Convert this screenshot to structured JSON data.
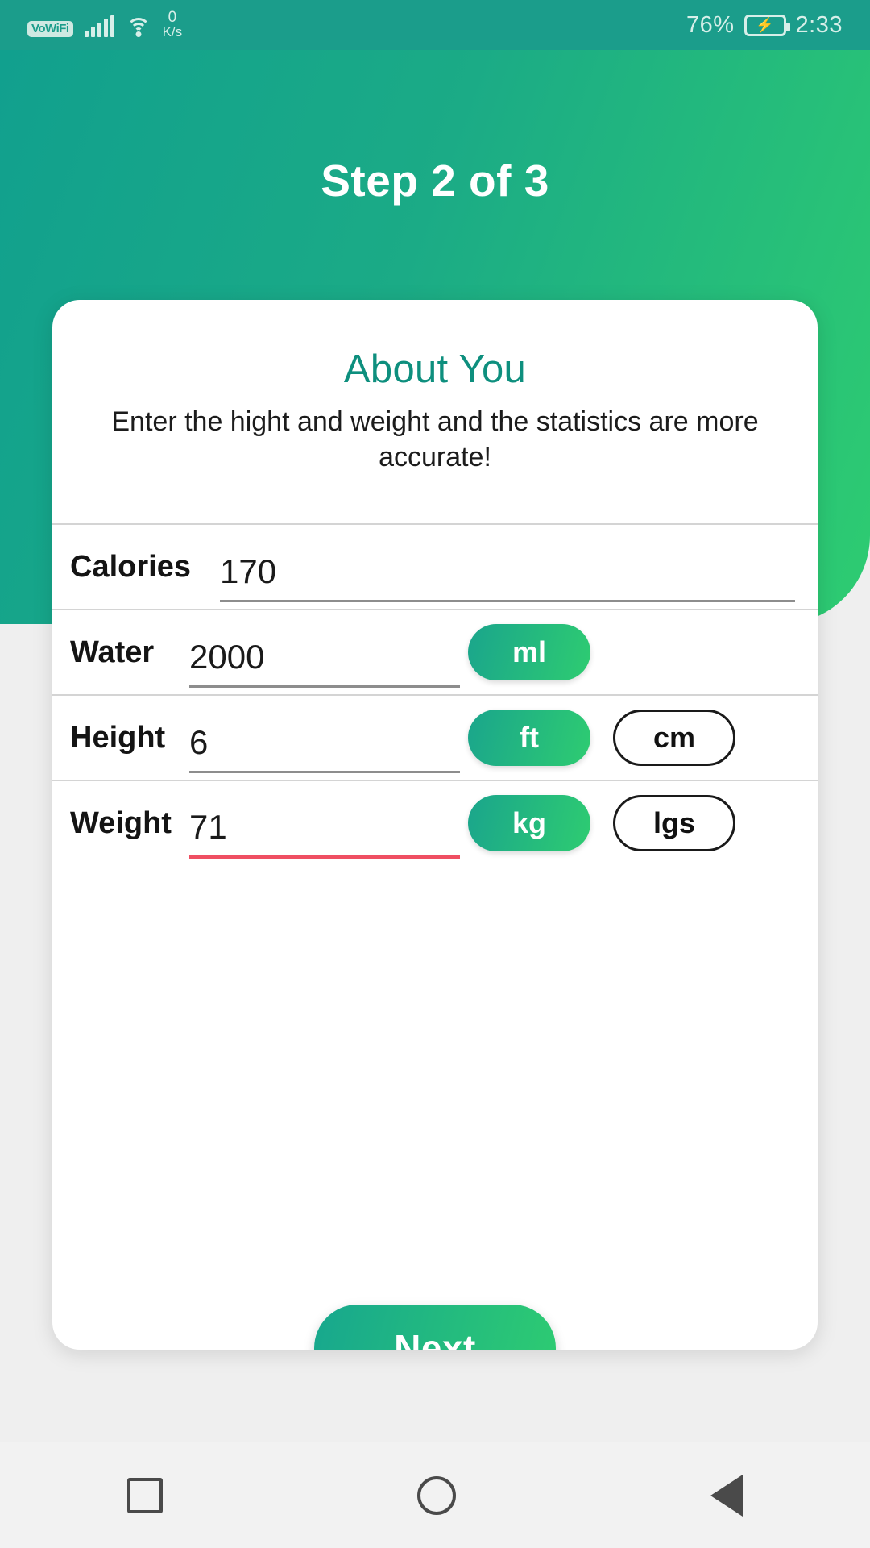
{
  "statusbar": {
    "vowifi_badge": "VoWiFi",
    "signal_icon": "signal-bars-icon",
    "wifi_icon": "wifi-icon",
    "net_speed_value": "0",
    "net_speed_unit": "K/s",
    "battery_percent": "76%",
    "battery_icon": "battery-charging-icon",
    "charging_glyph": "⚡",
    "time": "2:33",
    "background_color": "#1b9d8b"
  },
  "header": {
    "step_title": "Step 2 of 3",
    "gradient_from": "#11a08e",
    "gradient_to": "#2ecc71"
  },
  "card": {
    "title": "About You",
    "title_color": "#0e8f7e",
    "subtitle": "Enter the hight and weight and the statistics are more accurate!",
    "rows": [
      {
        "label": "Calories",
        "value": "170",
        "unit_primary": null,
        "unit_secondary": null,
        "underline_color": "#8d8d8d",
        "error": false
      },
      {
        "label": "Water",
        "value": "2000",
        "unit_primary": "ml",
        "unit_secondary": null,
        "underline_color": "#8d8d8d",
        "error": false
      },
      {
        "label": "Height",
        "value": "6",
        "unit_primary": "ft",
        "unit_secondary": "cm",
        "underline_color": "#8d8d8d",
        "error": false
      },
      {
        "label": "Weight",
        "value": "71",
        "unit_primary": "kg",
        "unit_secondary": "lgs",
        "underline_color": "#ef4f62",
        "error": true
      }
    ]
  },
  "actions": {
    "next_label": "Next"
  },
  "navbar": {
    "recent_icon": "square-recents-icon",
    "home_icon": "circle-home-icon",
    "back_icon": "triangle-back-icon"
  },
  "colors": {
    "accent_teal": "#1b9d8b",
    "accent_green": "#2ecc71",
    "error_red": "#ef4f62"
  }
}
